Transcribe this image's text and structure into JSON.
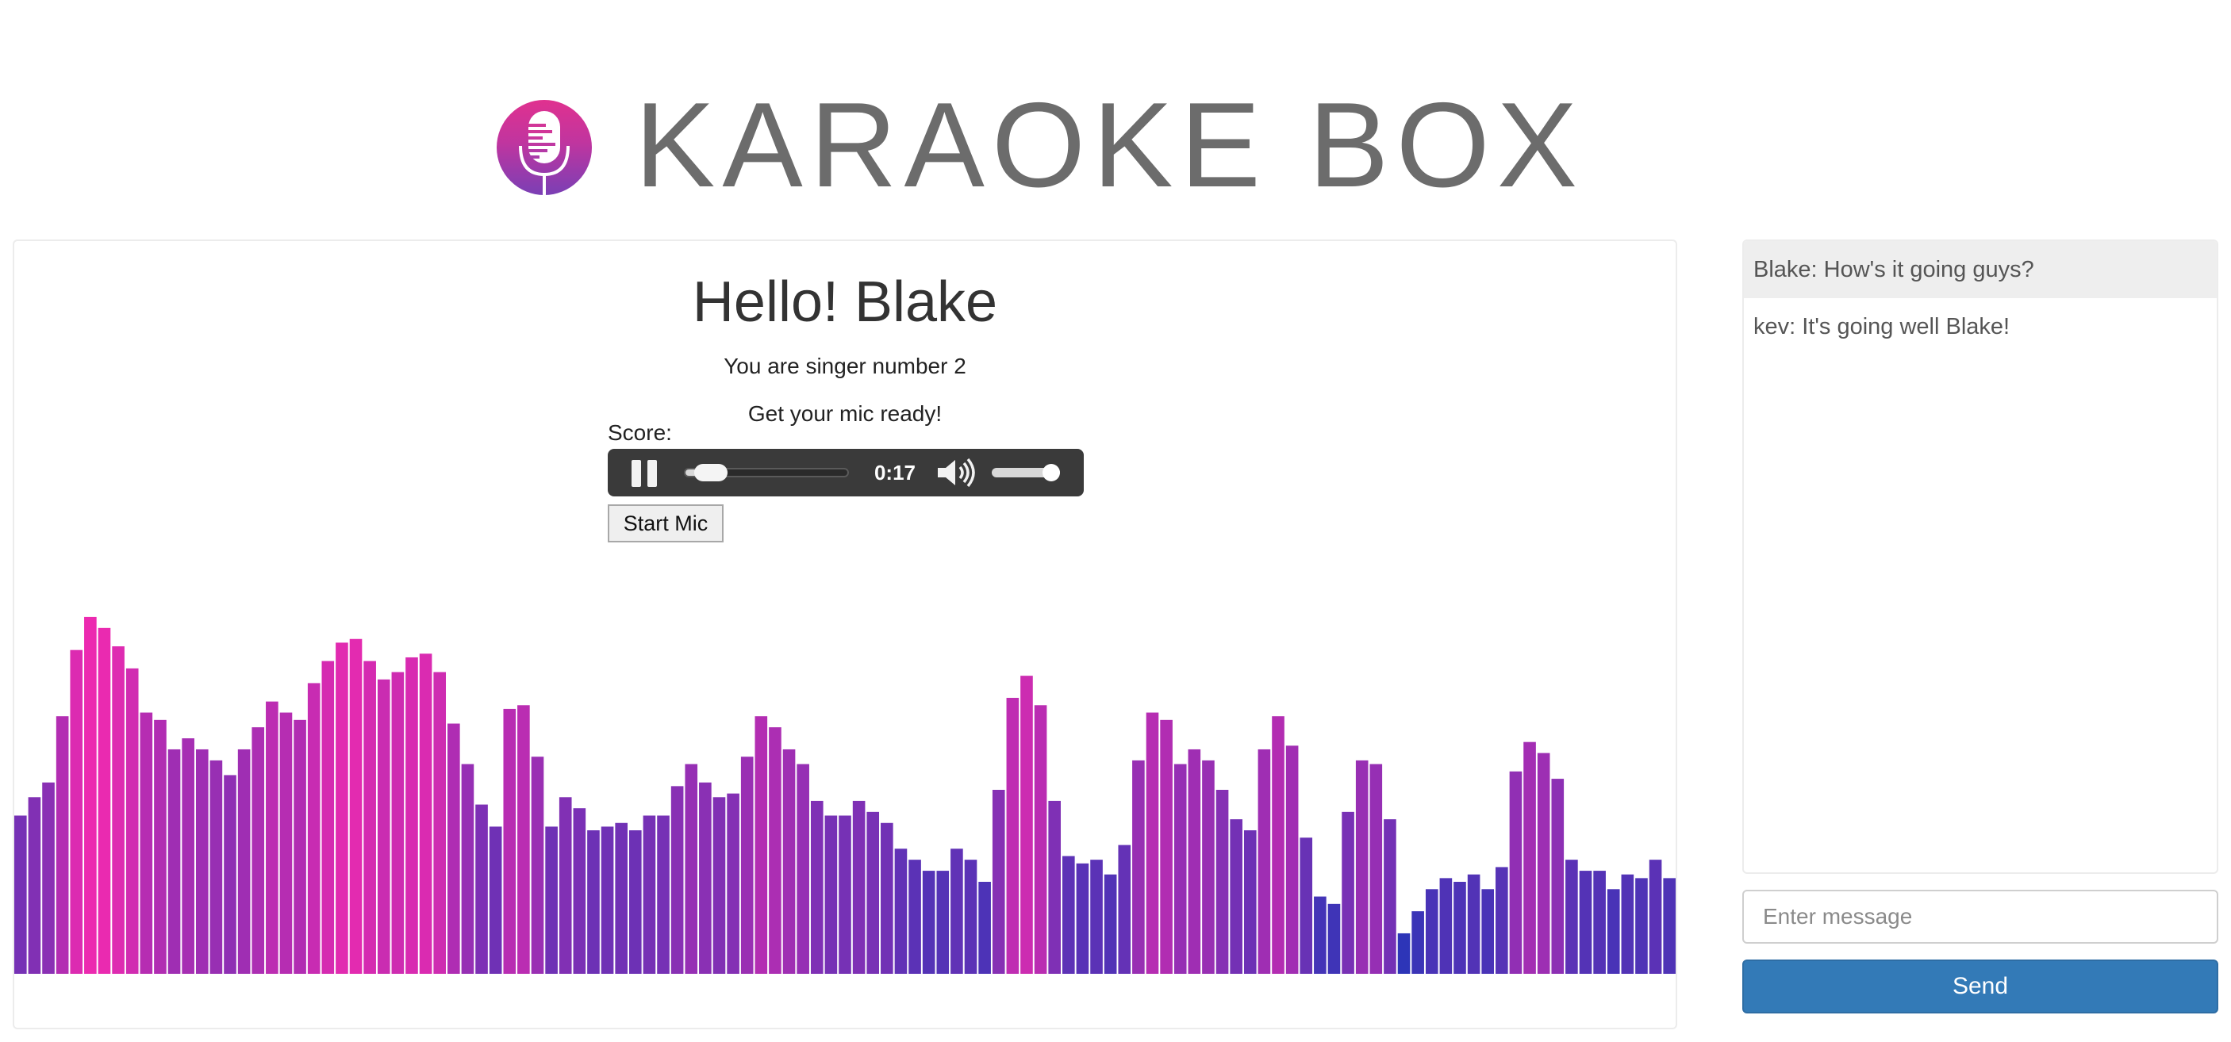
{
  "app": {
    "title": "KARAOKE BOX"
  },
  "colors": {
    "brand_pink": "#e0318f",
    "brand_purple": "#7a3fb5",
    "bar_low": "#2b35b8",
    "bar_high": "#ec2ab0",
    "send_button": "#337ab7",
    "player_bg": "#3a3a3a"
  },
  "main": {
    "greeting": "Hello! Blake",
    "singer_status": "You are singer number 2",
    "prompt": "Get your mic ready!",
    "score_label": "Score:",
    "start_mic_label": "Start Mic"
  },
  "player": {
    "time": "0:17",
    "progress_fraction": 0.08,
    "volume_fraction": 1.0,
    "state": "playing",
    "icons": [
      "pause-icon",
      "volume-icon"
    ]
  },
  "visualizer": {
    "levels": [
      0.43,
      0.48,
      0.52,
      0.7,
      0.88,
      0.97,
      0.94,
      0.89,
      0.83,
      0.71,
      0.69,
      0.61,
      0.64,
      0.61,
      0.58,
      0.54,
      0.61,
      0.67,
      0.74,
      0.71,
      0.69,
      0.79,
      0.85,
      0.9,
      0.91,
      0.85,
      0.8,
      0.82,
      0.86,
      0.87,
      0.82,
      0.68,
      0.57,
      0.46,
      0.4,
      0.72,
      0.73,
      0.59,
      0.4,
      0.48,
      0.45,
      0.39,
      0.4,
      0.41,
      0.39,
      0.43,
      0.43,
      0.51,
      0.57,
      0.52,
      0.48,
      0.49,
      0.59,
      0.7,
      0.67,
      0.61,
      0.57,
      0.47,
      0.43,
      0.43,
      0.47,
      0.44,
      0.41,
      0.34,
      0.31,
      0.28,
      0.28,
      0.34,
      0.31,
      0.25,
      0.5,
      0.75,
      0.81,
      0.73,
      0.47,
      0.32,
      0.3,
      0.31,
      0.27,
      0.35,
      0.58,
      0.71,
      0.69,
      0.57,
      0.61,
      0.58,
      0.5,
      0.42,
      0.39,
      0.61,
      0.7,
      0.62,
      0.37,
      0.21,
      0.19,
      0.44,
      0.58,
      0.57,
      0.42,
      0.11,
      0.17,
      0.23,
      0.26,
      0.25,
      0.27,
      0.23,
      0.29,
      0.55,
      0.63,
      0.6,
      0.53,
      0.31,
      0.28,
      0.28,
      0.23,
      0.27,
      0.26,
      0.31,
      0.26
    ]
  },
  "chat": {
    "messages": [
      {
        "text": "Blake: How's it going guys?"
      },
      {
        "text": "kev: It's going well Blake!"
      }
    ],
    "input_placeholder": "Enter message",
    "input_value": "",
    "send_label": "Send"
  }
}
